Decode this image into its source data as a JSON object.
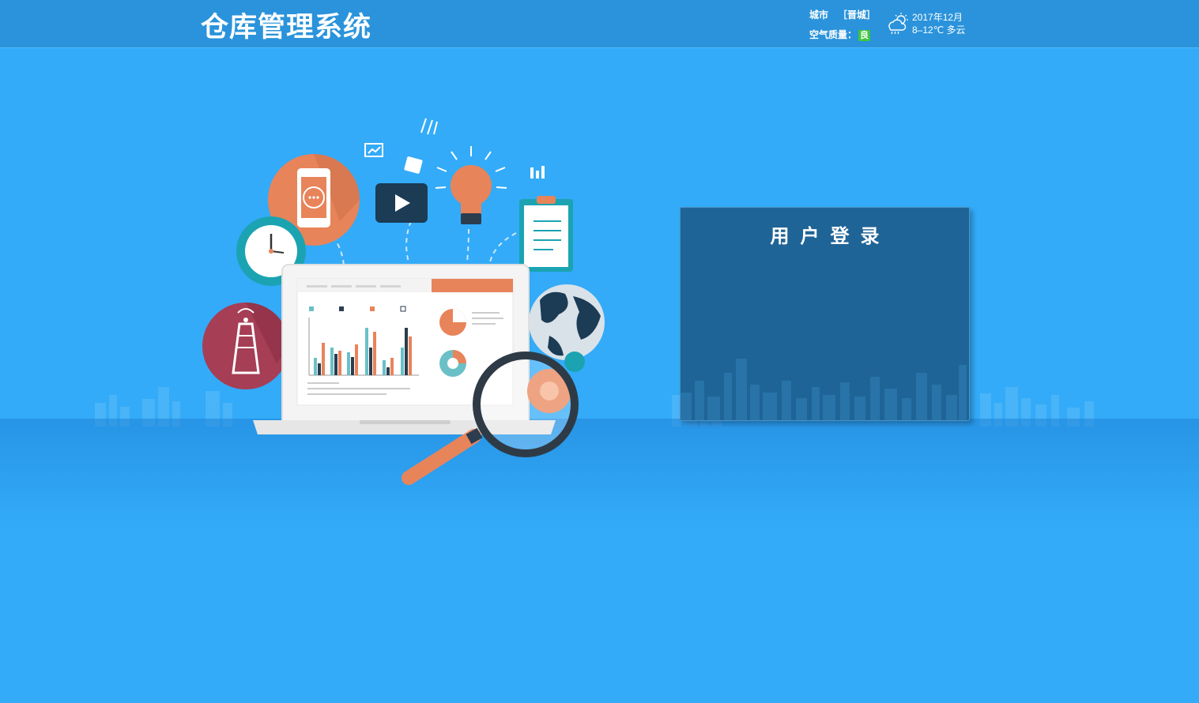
{
  "header": {
    "title": "仓库管理系统",
    "city_label": "城市",
    "city_name": "［晋城］",
    "air_quality_label": "空气质量：",
    "air_quality_value": "良",
    "weather_date": "2017年12月",
    "weather_detail": "8–12℃  多云",
    "weather_icon": "cloud-sun-rain-icon"
  },
  "login": {
    "title": "用户登录"
  },
  "colors": {
    "background": "#33abf8",
    "topbar": "#2a93db",
    "login_panel": "#1f6496",
    "air_quality_good": "#3ec63e",
    "accent_orange": "#e8845a"
  }
}
